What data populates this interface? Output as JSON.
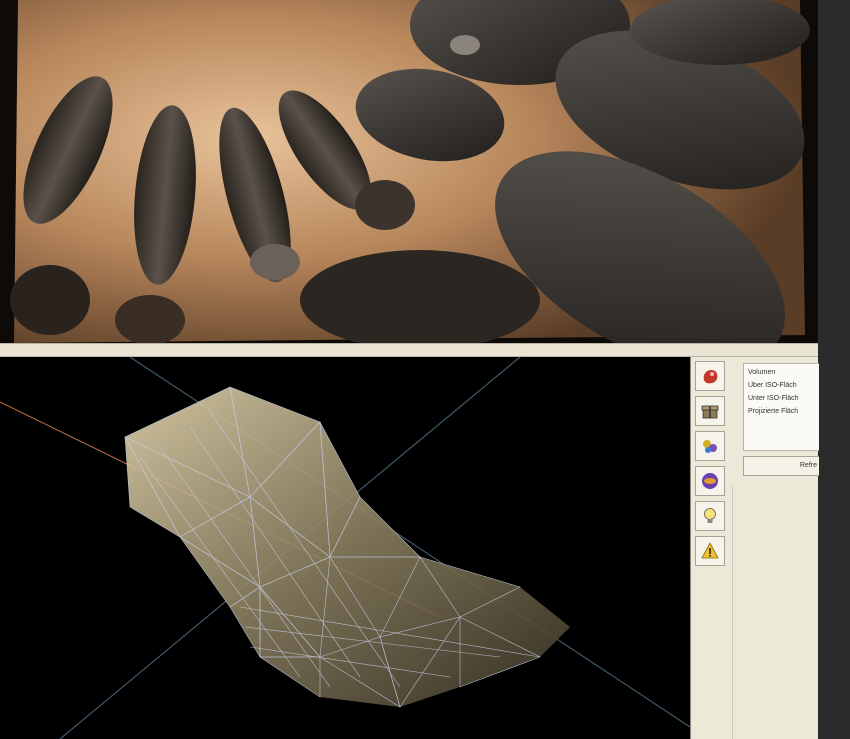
{
  "panel": {
    "properties": [
      {
        "label": "Volumen"
      },
      {
        "label": "Über ISO-Fläch"
      },
      {
        "label": "Unter ISO-Fläch"
      },
      {
        "label": "Projizierte Fläch"
      }
    ],
    "refresh_label": "Refre"
  },
  "toolbar": {
    "buttons": [
      {
        "icon": "red-blob-icon"
      },
      {
        "icon": "gift-box-icon"
      },
      {
        "icon": "spheres-icon"
      },
      {
        "icon": "purple-disc-icon"
      },
      {
        "icon": "lightbulb-icon"
      },
      {
        "icon": "warning-icon"
      }
    ]
  },
  "colors": {
    "panel_bg": "#ece9d8",
    "viewport_bg": "#000000",
    "copper": "#c89a6a",
    "mesh": "#c8cde8"
  }
}
